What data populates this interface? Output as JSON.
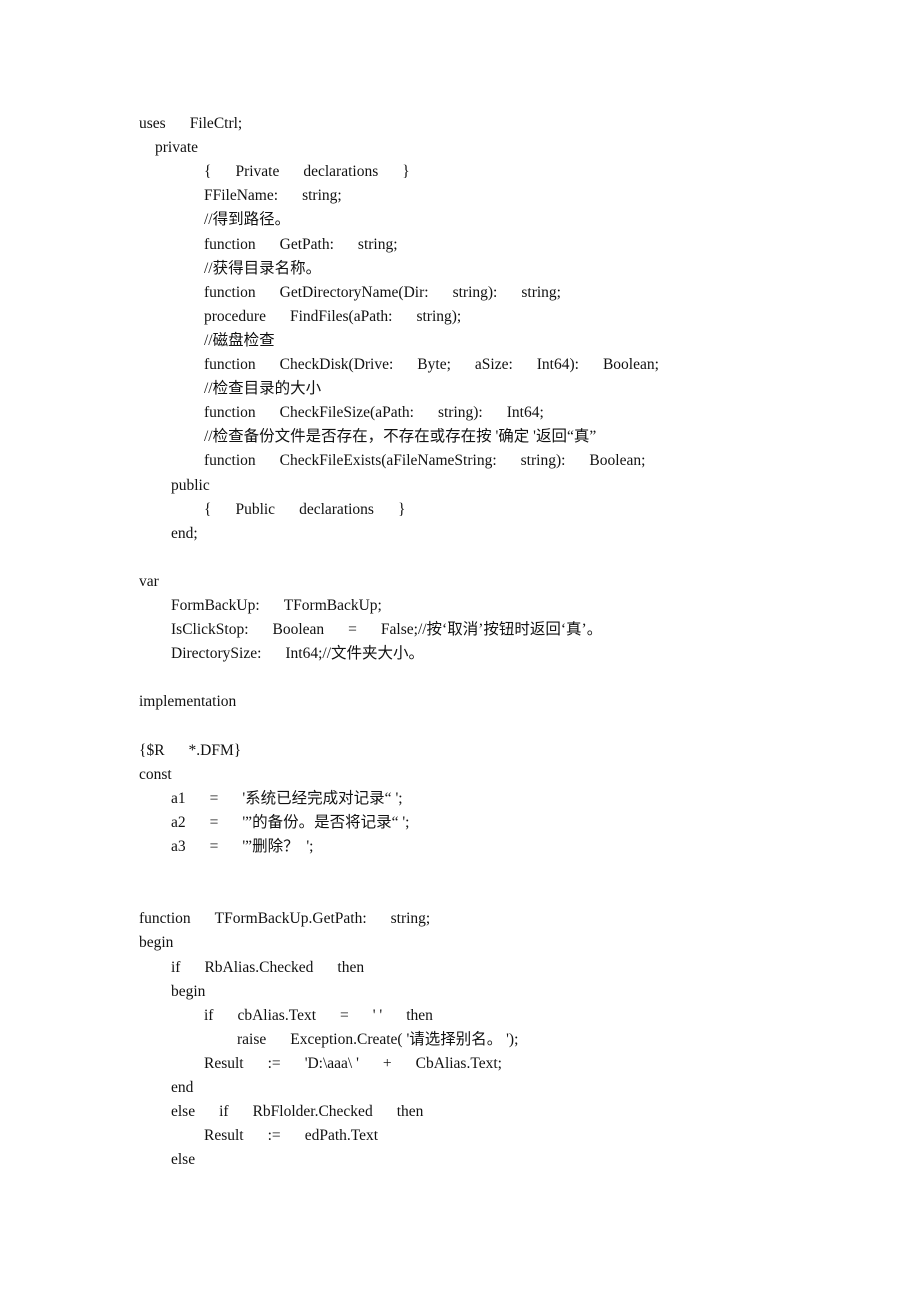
{
  "document": {
    "lines": [
      {
        "indent": 0,
        "tokens": [
          "uses",
          "FileCtrl;"
        ]
      },
      {
        "indent": 1,
        "tokens": [
          "private"
        ]
      },
      {
        "indent": 3,
        "tokens": [
          "{",
          "Private",
          "declarations",
          "}"
        ]
      },
      {
        "indent": 3,
        "tokens": [
          "FFileName:",
          "string;"
        ]
      },
      {
        "indent": 3,
        "tokens": [
          "//得到路径。"
        ]
      },
      {
        "indent": 3,
        "tokens": [
          "function",
          "GetPath:",
          "string;"
        ]
      },
      {
        "indent": 3,
        "tokens": [
          "//获得目录名称。"
        ]
      },
      {
        "indent": 3,
        "tokens": [
          "function",
          "GetDirectoryName(Dir:",
          "string):",
          "string;"
        ]
      },
      {
        "indent": 3,
        "tokens": [
          "procedure",
          "FindFiles(aPath:",
          "string);"
        ]
      },
      {
        "indent": 3,
        "tokens": [
          "//磁盘检查"
        ]
      },
      {
        "indent": 3,
        "tokens": [
          "function",
          "CheckDisk(Drive:",
          "Byte;",
          "aSize:",
          "Int64):",
          "Boolean;"
        ]
      },
      {
        "indent": 3,
        "tokens": [
          "//检查目录的大小"
        ]
      },
      {
        "indent": 3,
        "tokens": [
          "function",
          "CheckFileSize(aPath:",
          "string):",
          "Int64;"
        ]
      },
      {
        "indent": 3,
        "tokens": [
          "//检查备份文件是否存在，不存在或存在按 '确定 '返回“真”"
        ]
      },
      {
        "indent": 3,
        "tokens": [
          "function",
          "CheckFileExists(aFileNameString:",
          "string):",
          "Boolean;"
        ]
      },
      {
        "indent": 2,
        "tokens": [
          "public"
        ]
      },
      {
        "indent": 3,
        "tokens": [
          "{",
          "Public",
          "declarations",
          "}"
        ]
      },
      {
        "indent": 2,
        "tokens": [
          "end;"
        ]
      },
      {
        "indent": 0,
        "tokens": []
      },
      {
        "indent": 0,
        "tokens": [
          "var"
        ]
      },
      {
        "indent": 2,
        "tokens": [
          "FormBackUp:",
          "TFormBackUp;"
        ]
      },
      {
        "indent": 2,
        "tokens": [
          "IsClickStop:",
          "Boolean",
          "=",
          "False;//按‘取消’按钮时返回‘真’。"
        ]
      },
      {
        "indent": 2,
        "tokens": [
          "DirectorySize:",
          "Int64;//文件夹大小。"
        ]
      },
      {
        "indent": 0,
        "tokens": []
      },
      {
        "indent": 0,
        "tokens": [
          "implementation"
        ]
      },
      {
        "indent": 0,
        "tokens": []
      },
      {
        "indent": 0,
        "tokens": [
          "{$R",
          "*.DFM}"
        ]
      },
      {
        "indent": 0,
        "tokens": [
          "const"
        ]
      },
      {
        "indent": 2,
        "tokens": [
          "a1",
          "=",
          "'系统已经完成对记录“ ';"
        ]
      },
      {
        "indent": 2,
        "tokens": [
          "a2",
          "=",
          "'”的备份。是否将记录“ ';"
        ]
      },
      {
        "indent": 2,
        "tokens": [
          "a3",
          "=",
          "'”删除？  ';"
        ]
      },
      {
        "indent": 0,
        "tokens": []
      },
      {
        "indent": 0,
        "tokens": []
      },
      {
        "indent": 0,
        "tokens": [
          "function",
          "TFormBackUp.GetPath:",
          "string;"
        ]
      },
      {
        "indent": 0,
        "tokens": [
          "begin"
        ]
      },
      {
        "indent": 2,
        "tokens": [
          "if",
          "RbAlias.Checked",
          "then"
        ]
      },
      {
        "indent": 2,
        "tokens": [
          "begin"
        ]
      },
      {
        "indent": 3,
        "tokens": [
          "if",
          "cbAlias.Text",
          "=",
          "' '",
          "then"
        ]
      },
      {
        "indent": 4,
        "tokens": [
          "raise",
          "Exception.Create( '请选择别名。 ');"
        ]
      },
      {
        "indent": 3,
        "tokens": [
          "Result",
          ":=",
          "'D:\\aaa\\ '",
          "+",
          "CbAlias.Text;"
        ]
      },
      {
        "indent": 2,
        "tokens": [
          "end"
        ]
      },
      {
        "indent": 2,
        "tokens": [
          "else",
          "if",
          "RbFlolder.Checked",
          "then"
        ]
      },
      {
        "indent": 3,
        "tokens": [
          "Result",
          ":=",
          "edPath.Text"
        ]
      },
      {
        "indent": 2,
        "tokens": [
          "else"
        ]
      }
    ]
  }
}
